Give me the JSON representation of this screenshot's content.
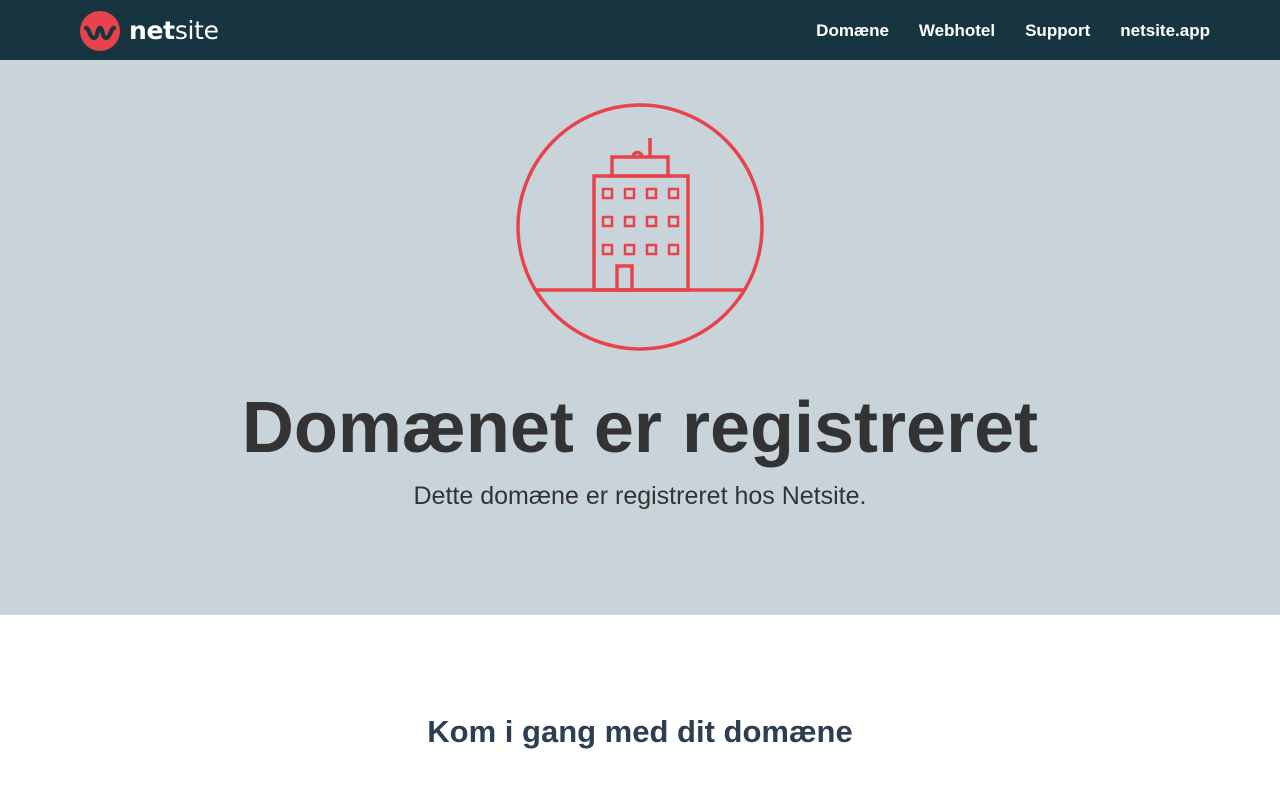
{
  "header": {
    "logo": {
      "bold": "net",
      "light": "site",
      "mark_color": "#e8424d",
      "icon": "netsite-logo-icon"
    },
    "nav": [
      {
        "label": "Domæne"
      },
      {
        "label": "Webhotel"
      },
      {
        "label": "Support"
      },
      {
        "label": "netsite.app"
      }
    ],
    "background": "#173441"
  },
  "hero": {
    "icon": "building-icon",
    "icon_color": "#e8424d",
    "background": "#c9d4da",
    "title": "Domænet er registreret",
    "subtitle": "Dette domæne er registreret hos Netsite."
  },
  "main": {
    "section_title": "Kom i gang med dit domæne"
  }
}
